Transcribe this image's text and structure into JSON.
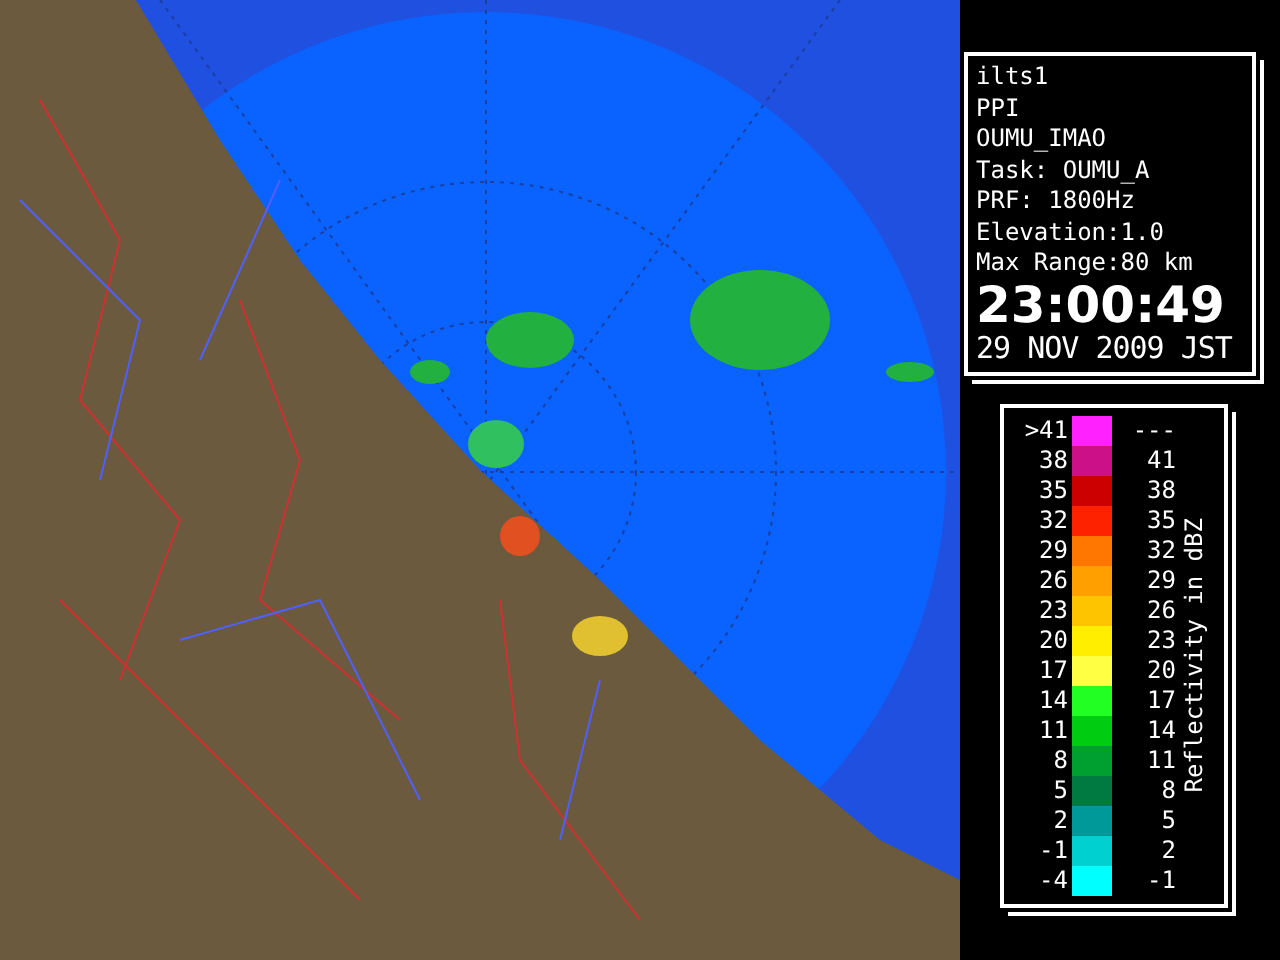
{
  "info_panel": {
    "lines": [
      "ilts1",
      "PPI",
      "OUMU_IMAO",
      "Task: OUMU_A",
      "PRF: 1800Hz",
      "Elevation:1.0",
      "Max Range:80 km"
    ],
    "time": "23:00:49",
    "date": "29 NOV 2009 JST"
  },
  "legend": {
    "title": "Reflectivity in dBZ",
    "rows": [
      {
        "low": ">41",
        "high": "---",
        "color": "#ff22ff"
      },
      {
        "low": "38",
        "high": "41",
        "color": "#cc1188"
      },
      {
        "low": "35",
        "high": "38",
        "color": "#cc0000"
      },
      {
        "low": "32",
        "high": "35",
        "color": "#ff2200"
      },
      {
        "low": "29",
        "high": "32",
        "color": "#ff7700"
      },
      {
        "low": "26",
        "high": "29",
        "color": "#ffa000"
      },
      {
        "low": "23",
        "high": "26",
        "color": "#ffc400"
      },
      {
        "low": "20",
        "high": "23",
        "color": "#ffee00"
      },
      {
        "low": "17",
        "high": "20",
        "color": "#ffff44"
      },
      {
        "low": "14",
        "high": "17",
        "color": "#22ff22"
      },
      {
        "low": "11",
        "high": "14",
        "color": "#00cc11"
      },
      {
        "low": "8",
        "high": "11",
        "color": "#00a030"
      },
      {
        "low": "5",
        "high": "8",
        "color": "#007a40"
      },
      {
        "low": "2",
        "high": "5",
        "color": "#009999"
      },
      {
        "low": "-1",
        "high": "2",
        "color": "#00d0d0"
      },
      {
        "low": "-4",
        "high": "-1",
        "color": "#00ffff"
      }
    ]
  }
}
